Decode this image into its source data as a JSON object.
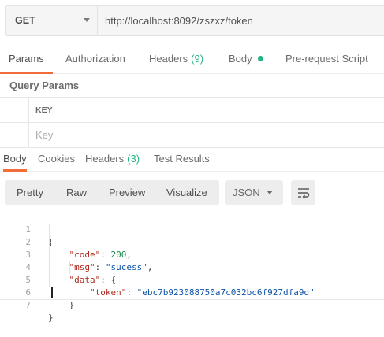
{
  "request": {
    "method": "GET",
    "url": "http://localhost:8092/zszxz/token"
  },
  "request_tabs": [
    {
      "label": "Params",
      "active": true
    },
    {
      "label": "Authorization"
    },
    {
      "label": "Headers",
      "count": "(9)"
    },
    {
      "label": "Body"
    },
    {
      "label": "Pre-request Script"
    }
  ],
  "query_params": {
    "title": "Query Params",
    "column_key": "KEY",
    "key_placeholder": "Key"
  },
  "response_tabs": [
    {
      "label": "Body",
      "active": true
    },
    {
      "label": "Cookies"
    },
    {
      "label": "Headers",
      "count": "(3)"
    },
    {
      "label": "Test Results"
    }
  ],
  "response_toolbar": {
    "views": [
      "Pretty",
      "Raw",
      "Preview",
      "Visualize"
    ],
    "format": "JSON",
    "icons": {
      "wrap": "wrap-lines-icon",
      "dropdown": "chevron-down-icon"
    }
  },
  "response_body": {
    "line_numbers": [
      "1",
      "2",
      "3",
      "4",
      "5",
      "6",
      "7"
    ],
    "lines": [
      "{",
      "    \"code\": 200,",
      "    \"msg\": \"sucess\",",
      "    \"data\": {",
      "        \"token\": \"ebc7b923088750a7c032bc6f927dfa9d\"",
      "    }",
      "}"
    ]
  },
  "colors": {
    "accent": "#f26b3a",
    "count": "#26b47f",
    "json_key": "#b0291f",
    "json_string": "#0b52a5",
    "json_number": "#1a8a4a"
  }
}
